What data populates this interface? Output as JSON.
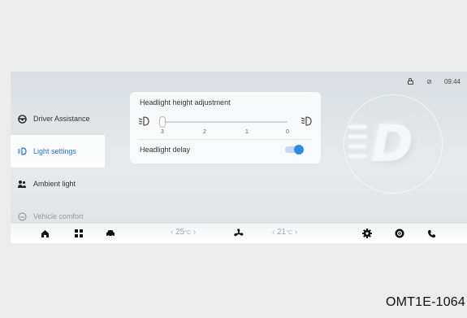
{
  "status": {
    "time": "09:44"
  },
  "sidebar": {
    "items": [
      {
        "label": "Driver Assistance"
      },
      {
        "label": "Light settings"
      },
      {
        "label": "Ambient light"
      },
      {
        "label": "Vehicle comfort"
      }
    ]
  },
  "headlight": {
    "title": "Headlight height adjustment",
    "ticks": [
      "3",
      "2",
      "1",
      "0"
    ],
    "level": 3,
    "delay_label": "Headlight delay",
    "delay_on": true
  },
  "climate": {
    "left_temp": "25",
    "right_temp": "21",
    "unit": "°C",
    "left_arrow": "‹",
    "right_arrow": "›"
  },
  "colors": {
    "accent": "#2f8ae4",
    "active_text": "#2a6fd6"
  },
  "doc_code": "OMT1E-1064"
}
